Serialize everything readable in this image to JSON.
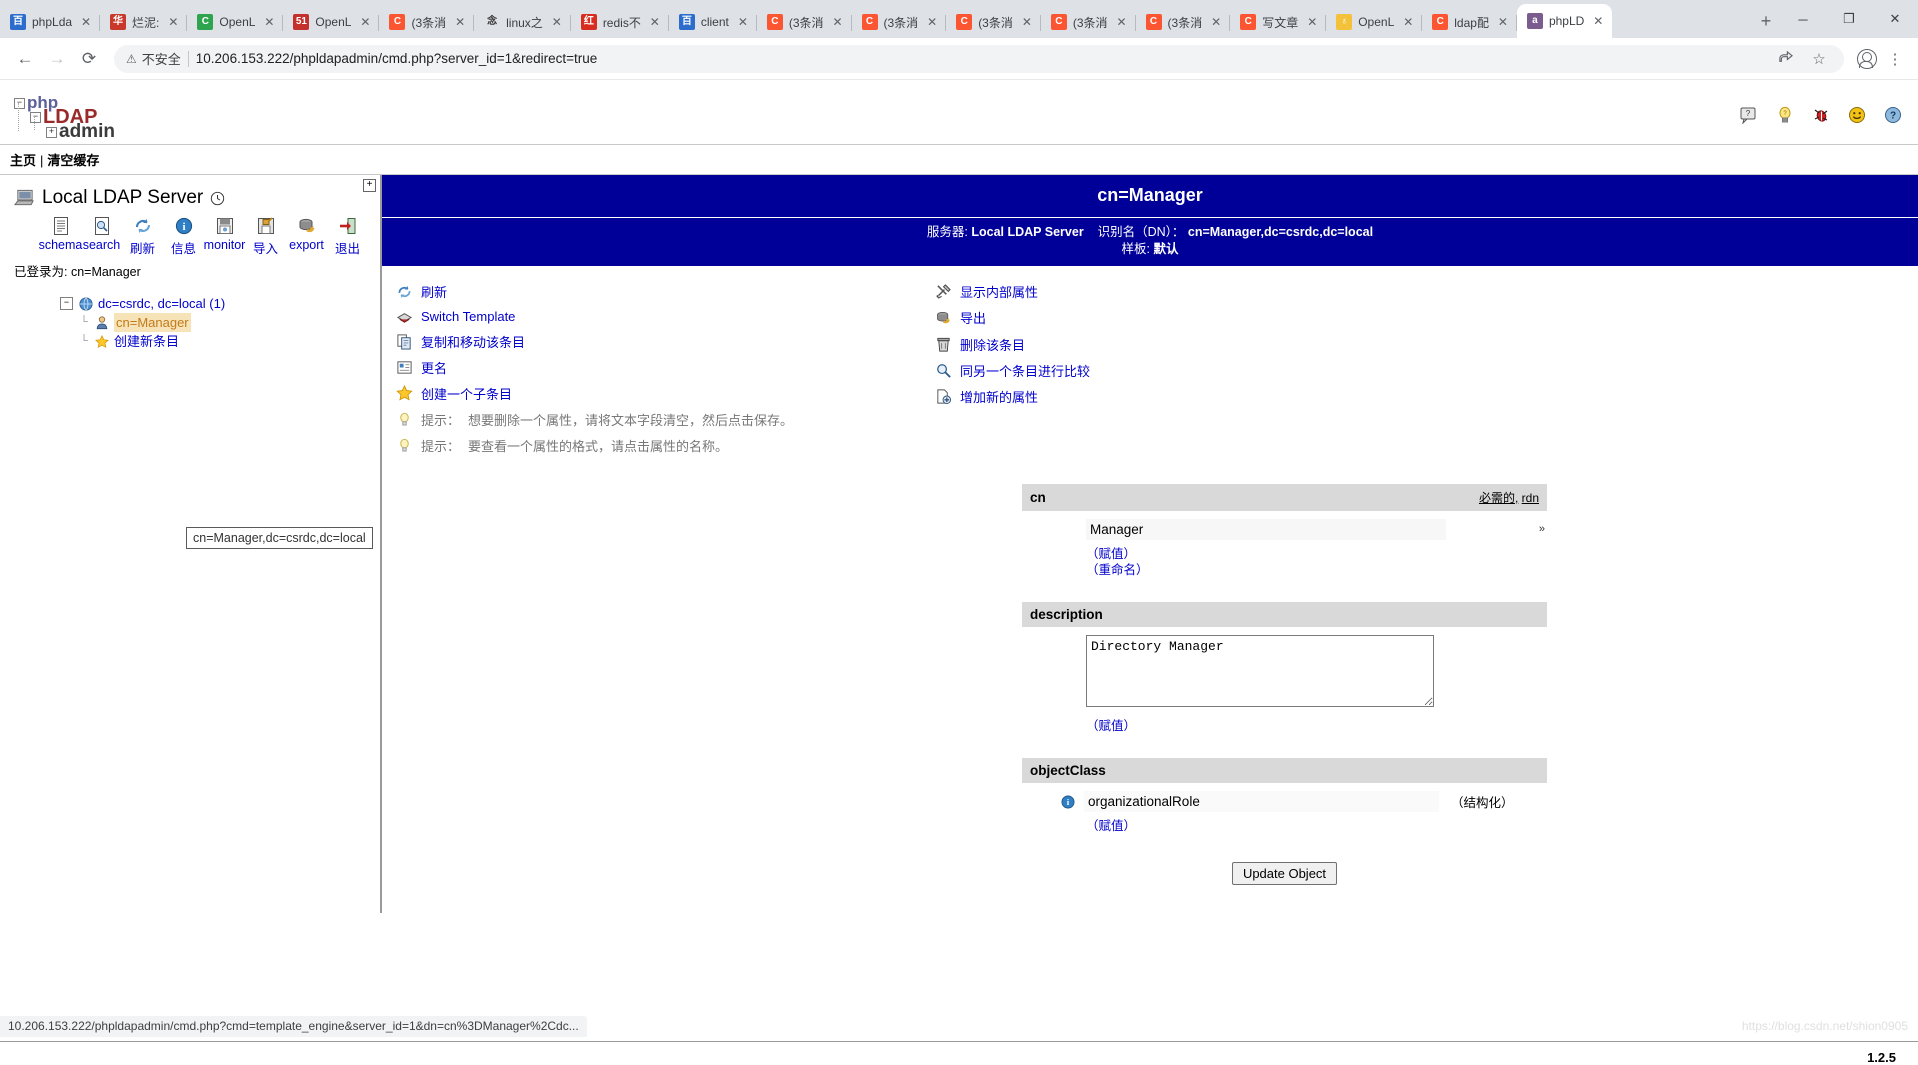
{
  "browser": {
    "tabs": [
      {
        "title": "phpLda",
        "favicon": "baidu-icon",
        "color": "#2b6ccc",
        "letter": "百",
        "active": false
      },
      {
        "title": "烂泥:",
        "favicon": "site-icon",
        "color": "#c8392b",
        "letter": "华",
        "active": false
      },
      {
        "title": "OpenL",
        "favicon": "csdn-green-icon",
        "color": "#2ea44f",
        "letter": "C",
        "active": false
      },
      {
        "title": "OpenL",
        "favicon": "51cto-icon",
        "color": "#c4302b",
        "letter": "51",
        "active": false
      },
      {
        "title": "(3条消",
        "favicon": "csdn-icon",
        "color": "#fc5531",
        "letter": "C",
        "active": false
      },
      {
        "title": "linux之",
        "favicon": "site-icon",
        "color": "#ffffff",
        "letter": "念",
        "active": false
      },
      {
        "title": "redis不",
        "favicon": "redis-icon",
        "color": "#d82c20",
        "letter": "红",
        "active": false
      },
      {
        "title": "client",
        "favicon": "baidu-icon",
        "color": "#2b6ccc",
        "letter": "百",
        "active": false
      },
      {
        "title": "(3条消",
        "favicon": "csdn-icon",
        "color": "#fc5531",
        "letter": "C",
        "active": false
      },
      {
        "title": "(3条消",
        "favicon": "csdn-icon",
        "color": "#fc5531",
        "letter": "C",
        "active": false
      },
      {
        "title": "(3条消",
        "favicon": "csdn-icon",
        "color": "#fc5531",
        "letter": "C",
        "active": false
      },
      {
        "title": "(3条消",
        "favicon": "csdn-icon",
        "color": "#fc5531",
        "letter": "C",
        "active": false
      },
      {
        "title": "(3条消",
        "favicon": "csdn-icon",
        "color": "#fc5531",
        "letter": "C",
        "active": false
      },
      {
        "title": "写文章",
        "favicon": "csdn-icon",
        "color": "#fc5531",
        "letter": "C",
        "active": false
      },
      {
        "title": "OpenL",
        "favicon": "trophy-icon",
        "color": "#f3c13a",
        "letter": "♁",
        "active": false
      },
      {
        "title": "ldap配",
        "favicon": "csdn-icon",
        "color": "#fc5531",
        "letter": "C",
        "active": false
      },
      {
        "title": "phpLD",
        "favicon": "phpldapadmin-icon",
        "color": "#7a5c8f",
        "letter": "a",
        "active": true
      }
    ],
    "new_tab_label": "+",
    "close_label": "✕",
    "window_controls": {
      "minimize": "─",
      "maximize": "❐",
      "close": "✕"
    },
    "nav": {
      "back": "←",
      "forward": "→",
      "reload": "⟳"
    },
    "security_label": "不安全",
    "url": "10.206.153.222/phpldapadmin/cmd.php?server_id=1&redirect=true",
    "omni_icons": {
      "share": "share-icon",
      "bookmark": "☆",
      "menu": "⋮"
    },
    "status_url": "10.206.153.222/phpldapadmin/cmd.php?cmd=template_engine&server_id=1&dn=cn%3DManager%2Cdc...",
    "watermark": "https://blog.csdn.net/shion0905"
  },
  "app": {
    "logo": {
      "php": "php",
      "ldap": "LDAP",
      "admin": "admin"
    },
    "header_icons": [
      {
        "name": "help-balloon-icon",
        "glyph": "?"
      },
      {
        "name": "lightbulb-icon",
        "glyph": "💡"
      },
      {
        "name": "bug-icon",
        "glyph": "🐞"
      },
      {
        "name": "smiley-icon",
        "glyph": "☺"
      },
      {
        "name": "question-help-icon",
        "glyph": "?"
      }
    ],
    "menubar": {
      "home": "主页",
      "separator": "|",
      "purge_cache": "清空缓存"
    },
    "version": "1.2.5"
  },
  "sidebar": {
    "server_name": "Local LDAP Server",
    "expand_box": "+",
    "tools": [
      {
        "label": "schema",
        "icon": "schema-icon"
      },
      {
        "label": "search",
        "icon": "search-icon"
      },
      {
        "label": "刷新",
        "icon": "refresh-icon"
      },
      {
        "label": "信息",
        "icon": "info-icon"
      },
      {
        "label": "monitor",
        "icon": "monitor-icon"
      },
      {
        "label": "导入",
        "icon": "import-icon"
      },
      {
        "label": "export",
        "icon": "export-icon"
      },
      {
        "label": "退出",
        "icon": "logout-icon"
      }
    ],
    "logged_in_as": "已登录为: cn=Manager",
    "tree": {
      "root": {
        "label": "dc=csrdc, dc=local (1)",
        "expander": "−",
        "icon": "globe-icon"
      },
      "children": [
        {
          "label": "cn=Manager",
          "icon": "user-icon",
          "selected": true
        },
        {
          "label": "创建新条目",
          "icon": "star-icon",
          "selected": false
        }
      ]
    },
    "tooltip": "cn=Manager,dc=csrdc,dc=local"
  },
  "entry": {
    "title": "cn=Manager",
    "server_label": "服务器:",
    "server_value": "Local LDAP Server",
    "dn_label": "识别名（DN）：",
    "dn_value": "cn=Manager,dc=csrdc,dc=local",
    "template_label": "样板:",
    "template_value": "默认"
  },
  "actions_left": [
    {
      "label": "刷新",
      "icon": "refresh-icon",
      "link": true
    },
    {
      "label": "Switch Template",
      "icon": "template-icon",
      "link": true
    },
    {
      "label": "复制和移动该条目",
      "icon": "copy-icon",
      "link": true
    },
    {
      "label": "更名",
      "icon": "rename-icon",
      "link": true
    },
    {
      "label": "创建一个子条目",
      "icon": "star-icon",
      "link": true
    }
  ],
  "hints": [
    {
      "prefix": "提示：",
      "text": "想要删除一个属性，请将文本字段清空，然后点击保存。",
      "icon": "lightbulb-icon"
    },
    {
      "prefix": "提示：",
      "text": "要查看一个属性的格式，请点击属性的名称。",
      "icon": "lightbulb-icon"
    }
  ],
  "actions_right": [
    {
      "label": "显示内部属性",
      "icon": "tools-icon"
    },
    {
      "label": "导出",
      "icon": "export-icon"
    },
    {
      "label": "删除该条目",
      "icon": "trash-icon"
    },
    {
      "label": "同另一个条目进行比较",
      "icon": "compare-icon"
    },
    {
      "label": "增加新的属性",
      "icon": "add-attribute-icon"
    }
  ],
  "attributes": [
    {
      "name": "cn",
      "meta_required": "必需的,",
      "meta_rdn": "rdn",
      "type": "text",
      "value": "Manager",
      "trailing_mark": "»",
      "links": [
        "（赋值）",
        "（重命名）"
      ]
    },
    {
      "name": "description",
      "meta_required": "",
      "meta_rdn": "",
      "type": "textarea",
      "value": "Directory Manager",
      "links": [
        "（赋值）"
      ]
    },
    {
      "name": "objectClass",
      "meta_required": "",
      "meta_rdn": "",
      "type": "objectclass",
      "value": "organizationalRole",
      "structural": "（结构化）",
      "links": [
        "（赋值）"
      ]
    }
  ],
  "update_button": "Update Object"
}
